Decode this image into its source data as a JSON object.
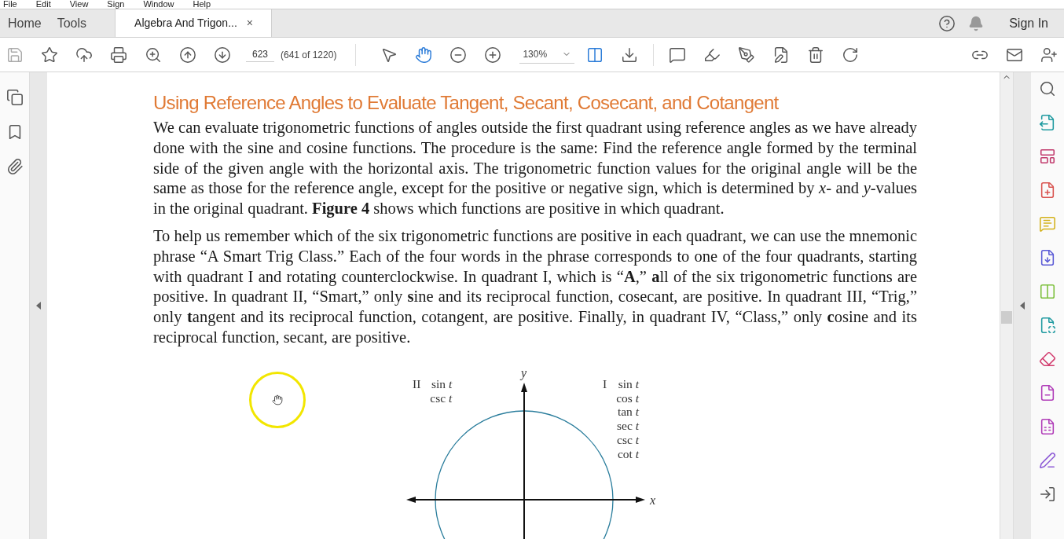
{
  "menu": [
    "File",
    "Edit",
    "View",
    "Sign",
    "Window",
    "Help"
  ],
  "tabs": [
    {
      "label": "Home",
      "selected": false,
      "kind": "nav"
    },
    {
      "label": "Tools",
      "selected": false,
      "kind": "nav"
    },
    {
      "label": "Algebra And Trigon...",
      "selected": true,
      "kind": "document"
    }
  ],
  "close_tab": "×",
  "sign_in": "Sign In",
  "toolbar": {
    "page_number": "623",
    "page_count": "(641 of 1220)",
    "zoom": "130%"
  },
  "document": {
    "heading": "Using Reference Angles to Evaluate Tangent, Secant, Cosecant, and Cotangent",
    "paragraphs": [
      "We can evaluate trigonometric functions of angles outside the first quadrant using reference angles as we have already done with the sine and cosine functions. The procedure is the same: Find the reference angle formed by the terminal side of the given angle with the horizontal axis. The trigonometric function values for the original angle will be the same as those for the reference angle, except for the positive or negative sign, which is determined by *x*- and *y*-values in the original quadrant. **Figure 4** shows which functions are positive in which quadrant.",
      "To help us remember which of the six trigonometric functions are positive in each quadrant, we can use the mnemonic phrase “A Smart Trig Class.” Each of the four words in the phrase corresponds to one of the four quadrants, starting with quadrant I and rotating counterclockwise. In quadrant I, which is “**A**,” **a**ll of the six trigonometric functions are positive. In quadrant II, “Smart,” only **s**ine and its reciprocal function, cosecant, are positive. In quadrant III, “Trig,” only **t**angent and its reciprocal function, cotangent, are positive. Finally, in quadrant IV, “Class,” only **c**osine and its reciprocal function, secant, are positive."
    ],
    "figure": {
      "y_label": "y",
      "x_label": "x",
      "quadrants": [
        {
          "numeral": "II",
          "functions": [
            "sin *t*",
            "csc *t*"
          ]
        },
        {
          "numeral": "I",
          "functions": [
            "sin *t*",
            "cos *t*",
            "tan *t*",
            "sec *t*",
            "csc *t*",
            "cot *t*"
          ]
        }
      ]
    }
  }
}
